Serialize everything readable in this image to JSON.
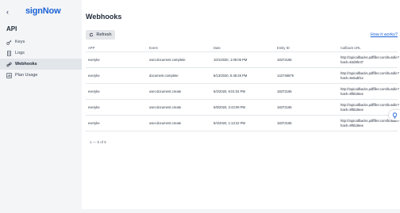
{
  "sidebar": {
    "logo": "signNow",
    "section_title": "API",
    "items": [
      {
        "label": "Keys",
        "icon": "key-icon",
        "active": false
      },
      {
        "label": "Logs",
        "icon": "document-icon",
        "active": false
      },
      {
        "label": "Webhooks",
        "icon": "link-icon",
        "active": true
      },
      {
        "label": "Plan Usage",
        "icon": "chart-icon",
        "active": false
      }
    ]
  },
  "main": {
    "title": "Webhooks",
    "refresh_label": "Refresh",
    "help_link": "How it works?",
    "columns": [
      "APP",
      "Event",
      "Date",
      "Entity ID",
      "Callback URL"
    ],
    "rows": [
      {
        "app": "everyke",
        "event": "user.document.complete",
        "date": "10/1/2020, 1:09:06 PM",
        "entity_id": "18372165",
        "url": "http://topicallbacks.pdffiller.com/bundle?hash=84d9fe37"
      },
      {
        "app": "everyke",
        "event": "document.complete",
        "date": "8/13/2020, 5:48:28 PM",
        "entity_id": "142748679",
        "url": "http://topicallbacks.pdffiller.com/bundle?hash=9e6abf1e"
      },
      {
        "app": "everyke",
        "event": "user.document.create",
        "date": "6/2/2020, 6:01:04 PM",
        "entity_id": "18372165",
        "url": "http://topicallbacks.pdffiller.com/bundle?hash=9f5b36ee"
      },
      {
        "app": "everyke",
        "event": "user.document.create",
        "date": "5/8/2020, 2:43:09 PM",
        "entity_id": "18372165",
        "url": "http://topicallbacks.pdffiller.com/bundle?hash=9f5b36ee"
      },
      {
        "app": "everyke",
        "event": "user.document.create",
        "date": "5/4/2020, 1:13:22 PM",
        "entity_id": "18372165",
        "url": "http://topicallbacks.pdffiller.com/bundle?hash=9f5b36ee"
      }
    ],
    "pagination": "1 — 5 of 5"
  },
  "colors": {
    "brand": "#1b62d6",
    "sidebar_bg": "#f4f5f7",
    "active_bg": "#e2e5ea"
  }
}
